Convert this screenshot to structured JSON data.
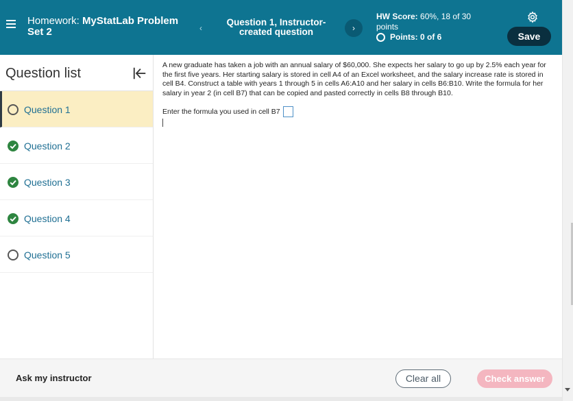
{
  "header": {
    "title_prefix": "Homework:",
    "title_name": "MyStatLab Problem Set 2",
    "question_title": "Question 1, Instructor-created question",
    "prev_symbol": "‹",
    "next_symbol": "›",
    "score_label": "HW Score:",
    "score_value": "60%, 18 of 30 points",
    "points": "Points: 0 of 6",
    "save_label": "Save"
  },
  "sidebar": {
    "title": "Question list",
    "items": [
      {
        "label": "Question 1",
        "status": "unanswered",
        "active": true
      },
      {
        "label": "Question 2",
        "status": "correct",
        "active": false
      },
      {
        "label": "Question 3",
        "status": "correct",
        "active": false
      },
      {
        "label": "Question 4",
        "status": "correct",
        "active": false
      },
      {
        "label": "Question 5",
        "status": "unanswered",
        "active": false
      }
    ]
  },
  "question": {
    "text": "A new graduate has taken a job with an annual salary of $60,000. She expects her salary to go up by 2.5% each year for the first five years. Her starting salary is stored in cell A4 of an Excel worksheet, and the salary increase rate is stored in cell B4. Construct a table with years 1 through 5 in cells A6:A10 and her salary in cells B6:B10. Write the formula for her salary in year 2 (in cell B7) that can be copied and pasted correctly in cells B8 through B10.",
    "prompt": "Enter the formula you used in cell B7"
  },
  "footer": {
    "ask_label": "Ask my instructor",
    "clear_label": "Clear all",
    "check_label": "Check answer"
  },
  "colors": {
    "header_bg": "#0e7491",
    "active_item_bg": "#fbeec3",
    "correct_green": "#2e8540",
    "check_btn_bg": "#f4b6c0",
    "save_btn_bg": "#0a2f3f"
  }
}
